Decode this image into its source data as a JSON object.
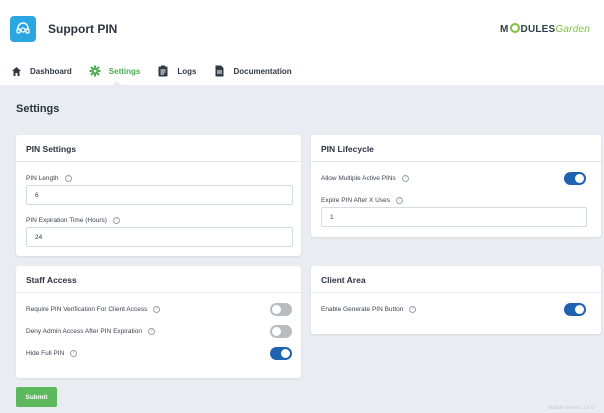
{
  "header": {
    "app_title": "Support PIN",
    "logo_text_left": "M",
    "logo_text_mid": "DULES",
    "logo_text_right": "Garden",
    "app_icon": "headset-icon",
    "accent_color": "#2aa7e0"
  },
  "nav": {
    "items": [
      {
        "label": "Dashboard",
        "icon": "home-icon",
        "active": false
      },
      {
        "label": "Settings",
        "icon": "gear-icon",
        "active": true
      },
      {
        "label": "Logs",
        "icon": "clipboard-icon",
        "active": false
      },
      {
        "label": "Documentation",
        "icon": "document-icon",
        "active": false
      }
    ],
    "active_color": "#4caf50"
  },
  "page": {
    "heading": "Settings"
  },
  "pin_settings": {
    "title": "PIN Settings",
    "pin_length_label": "PIN Length",
    "pin_length_value": "6",
    "expiration_label": "PIN Expiration Time (Hours)",
    "expiration_value": "24"
  },
  "pin_lifecycle": {
    "title": "PIN Lifecycle",
    "multiple_label": "Allow Multiple Active PINs",
    "multiple_on": true,
    "expire_label": "Expire PIN After X Uses",
    "expire_value": "1"
  },
  "staff_access": {
    "title": "Staff Access",
    "items": [
      {
        "label": "Require PIN Verification For Client Access",
        "on": false
      },
      {
        "label": "Deny Admin Access After PIN Expiration",
        "on": false
      },
      {
        "label": "Hide Full PIN",
        "on": true
      }
    ]
  },
  "client_area": {
    "title": "Client Area",
    "generate_label": "Enable Generate PIN Button",
    "generate_on": true
  },
  "actions": {
    "submit_label": "Submit"
  },
  "footer": {
    "version": "Module version 1.0.0"
  },
  "colors": {
    "toggle_on": "#1e63b0",
    "toggle_off": "#b7bcc1",
    "submit": "#5cb85c"
  }
}
